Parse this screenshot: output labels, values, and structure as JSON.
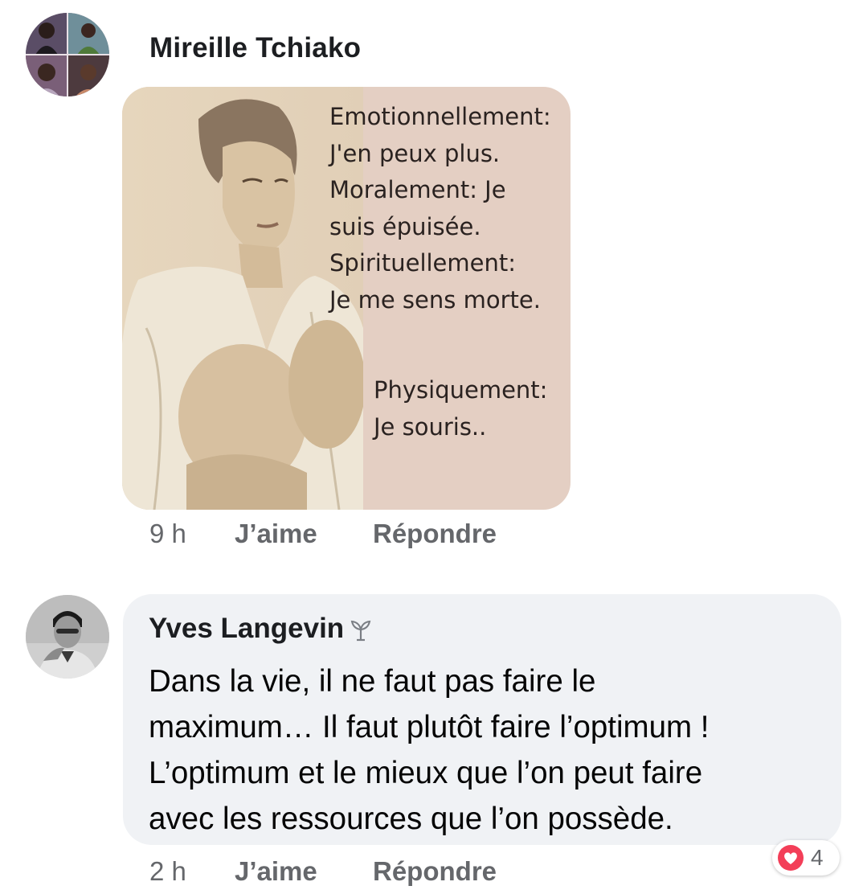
{
  "comments": [
    {
      "author": "Mireille Tchiako",
      "image": {
        "quote_top_lines": [
          "Emotionnellement:",
          "J'en peux plus.",
          "Moralement: Je",
          "suis épuisée.",
          "Spirituellement:",
          "Je me sens morte."
        ],
        "quote_bottom_lines": [
          "Physiquement:",
          "Je souris.."
        ]
      },
      "time": "9 h",
      "like_label": "J’aime",
      "reply_label": "Répondre"
    },
    {
      "author": "Yves Langevin",
      "badge_icon": "rising-fan-sprout-icon",
      "text_lines": [
        "Dans la vie, il ne faut pas faire le",
        "maximum… Il faut plutôt faire l’optimum !",
        "L’optimum et le mieux que l’on peut faire",
        "avec les ressources que l’on possède."
      ],
      "time": "2 h",
      "like_label": "J’aime",
      "reply_label": "Répondre",
      "reaction": {
        "icon": "love-reaction-icon",
        "count": "4",
        "color": "#f33e58"
      }
    }
  ],
  "colors": {
    "bubble_bg": "#f0f2f5",
    "meta_text": "#65676b",
    "name_text": "#1c1e21",
    "image_bg": "#e4cfc3"
  }
}
